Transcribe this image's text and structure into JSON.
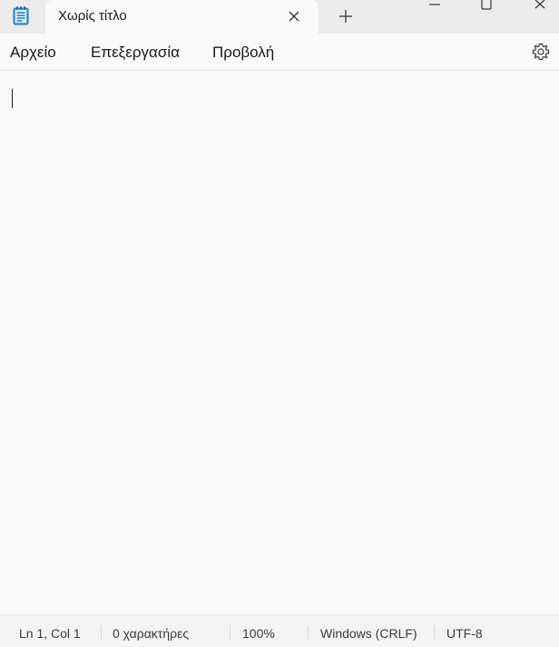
{
  "window": {
    "tab_title": "Χωρίς τίτλο",
    "icons": {
      "app": "notepad-icon",
      "tab_close": "close-icon",
      "new_tab": "plus-icon",
      "minimize": "minimize-icon",
      "maximize": "maximize-icon",
      "close": "close-icon"
    }
  },
  "menu": {
    "file": "Αρχείο",
    "edit": "Επεξεργασία",
    "view": "Προβολή",
    "settings_icon": "gear-icon"
  },
  "editor": {
    "content": ""
  },
  "status": {
    "position": "Ln 1, Col 1",
    "characters": "0 χαρακτήρες",
    "zoom": "100%",
    "line_ending": "Windows (CRLF)",
    "encoding": "UTF-8"
  },
  "colors": {
    "titlebar": "#ebebeb",
    "background": "#f9f9f9",
    "statusbar": "#f3f3f3",
    "accent": "#0b6fbf"
  }
}
